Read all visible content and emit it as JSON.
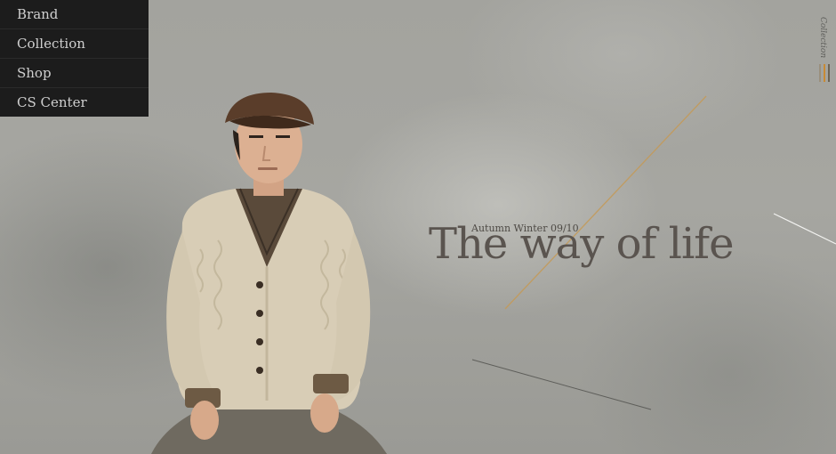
{
  "nav": {
    "items": [
      {
        "label": "Brand"
      },
      {
        "label": "Collection"
      },
      {
        "label": "Shop"
      },
      {
        "label": "CS Center"
      }
    ]
  },
  "side_tab": {
    "label": "Collection",
    "bar_colors": [
      "#9a8f7c",
      "#c98a34",
      "#6b6355"
    ]
  },
  "hero": {
    "subtitle": "Autumn Winter 09/10",
    "headline": "The way of life"
  },
  "colors": {
    "nav_background": "#1c1c1c",
    "nav_text": "#cfcfcf",
    "accent_line": "#c49a58",
    "headline": "#5a544f"
  }
}
